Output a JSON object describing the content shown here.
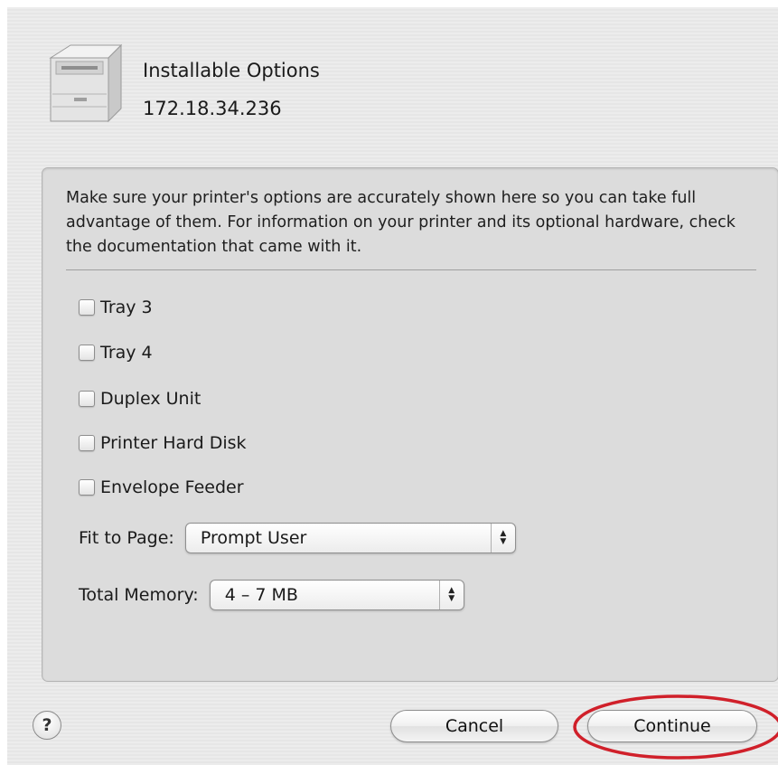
{
  "header": {
    "title": "Installable Options",
    "subtitle": "172.18.34.236",
    "icon": "printer-icon"
  },
  "panel": {
    "description": "Make sure your printer's options are accurately shown here so you can take full advantage of them.  For information on your printer and its optional hardware, check the documentation that came with it.",
    "options": [
      {
        "label": "Tray 3",
        "checked": false
      },
      {
        "label": "Tray 4",
        "checked": false
      },
      {
        "label": "Duplex Unit",
        "checked": false
      },
      {
        "label": "Printer Hard Disk",
        "checked": false
      },
      {
        "label": "Envelope Feeder",
        "checked": false
      }
    ],
    "fit_to_page": {
      "label": "Fit to Page:",
      "value": "Prompt User"
    },
    "total_memory": {
      "label": "Total Memory:",
      "value": "4 – 7 MB"
    }
  },
  "footer": {
    "help_label": "?",
    "cancel_label": "Cancel",
    "continue_label": "Continue"
  },
  "colors": {
    "highlight_ring": "#d0202a"
  }
}
